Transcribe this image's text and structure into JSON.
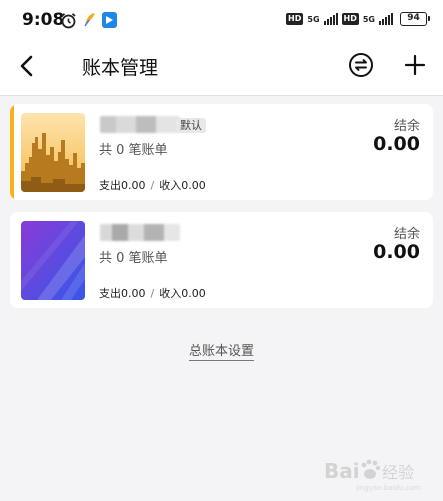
{
  "status_bar": {
    "time": "9:08",
    "hd_1": "HD",
    "net_1": "5G",
    "hd_2": "HD",
    "net_2": "5G",
    "battery": "94"
  },
  "header": {
    "title": "账本管理"
  },
  "books": [
    {
      "default_badge": "默认",
      "count": "共 0 笔账单",
      "expense": "支出0.00",
      "separator": "/",
      "income": "收入0.00",
      "balance_label": "结余",
      "balance": "0.00"
    },
    {
      "count": "共 0 笔账单",
      "expense": "支出0.00",
      "separator": "/",
      "income": "收入0.00",
      "balance_label": "结余",
      "balance": "0.00"
    }
  ],
  "footer": {
    "settings_link": "总账本设置"
  },
  "colors": {
    "accent": "#f7b317",
    "background": "#f4f4f6"
  }
}
